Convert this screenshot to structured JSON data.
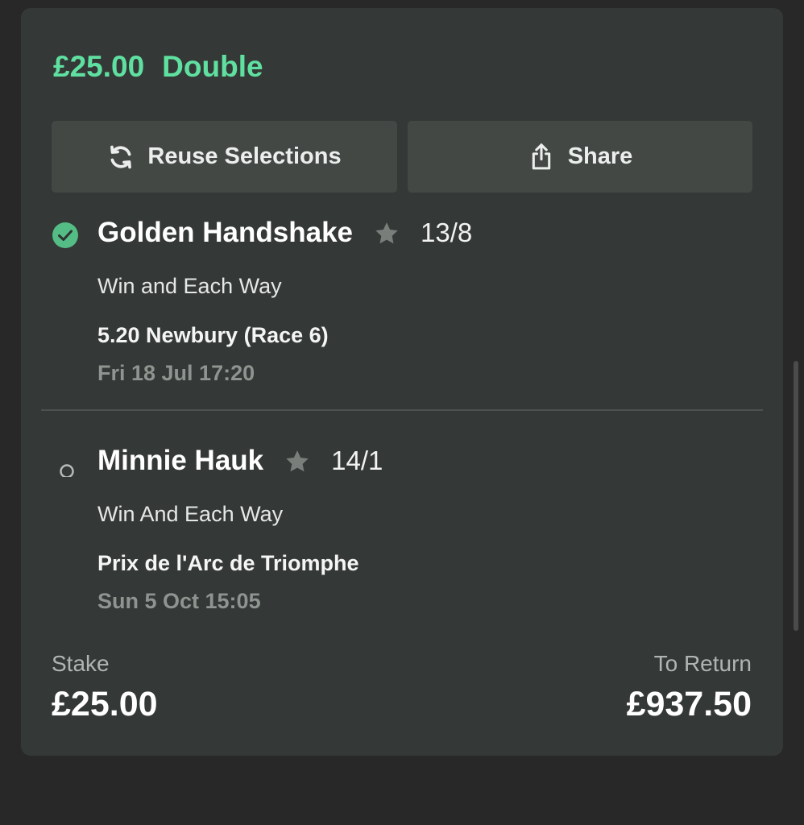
{
  "header": {
    "amount": "£25.00",
    "bet_type": "Double",
    "accent_color": "#5fe0a0"
  },
  "actions": {
    "reuse_label": "Reuse Selections",
    "reuse_icon": "refresh-icon",
    "share_label": "Share",
    "share_icon": "share-icon"
  },
  "selections": [
    {
      "status": "won",
      "status_icon": "check-circle-icon",
      "name": "Golden Handshake",
      "odds": "13/8",
      "market": "Win and Each Way",
      "event": "5.20 Newbury (Race 6)",
      "date": "Fri 18 Jul 17:20"
    },
    {
      "status": "open",
      "status_icon": "open-circle-icon",
      "name": "Minnie Hauk",
      "odds": "14/1",
      "market": "Win And Each Way",
      "event": "Prix de l'Arc de Triomphe",
      "date": "Sun 5 Oct 15:05"
    }
  ],
  "summary": {
    "stake_label": "Stake",
    "stake_value": "£25.00",
    "return_label": "To Return",
    "return_value": "£937.50"
  }
}
